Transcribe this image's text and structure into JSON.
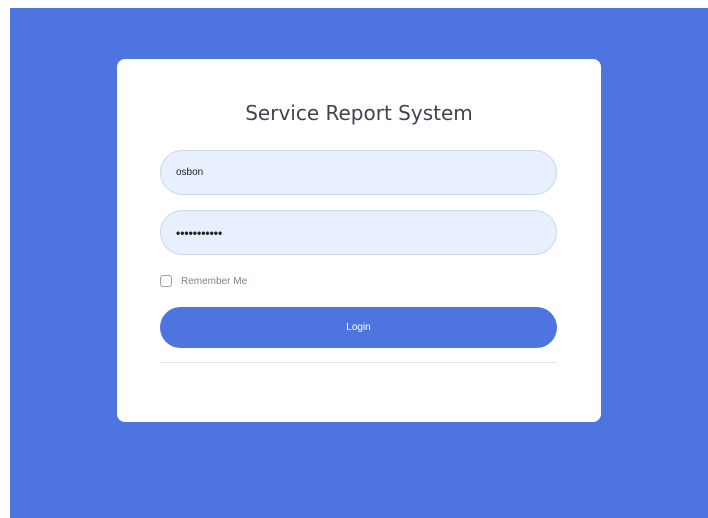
{
  "login_card": {
    "title": "Service Report System",
    "username": {
      "value": "osbon"
    },
    "password": {
      "value": "•••••••••••"
    },
    "remember_me": {
      "label": "Remember Me",
      "checked": false
    },
    "login_button": {
      "label": "Login"
    }
  },
  "colors": {
    "background": "#4e74e0",
    "card": "#ffffff",
    "input_fill": "#e8f0fe",
    "button": "#4e74e0"
  }
}
